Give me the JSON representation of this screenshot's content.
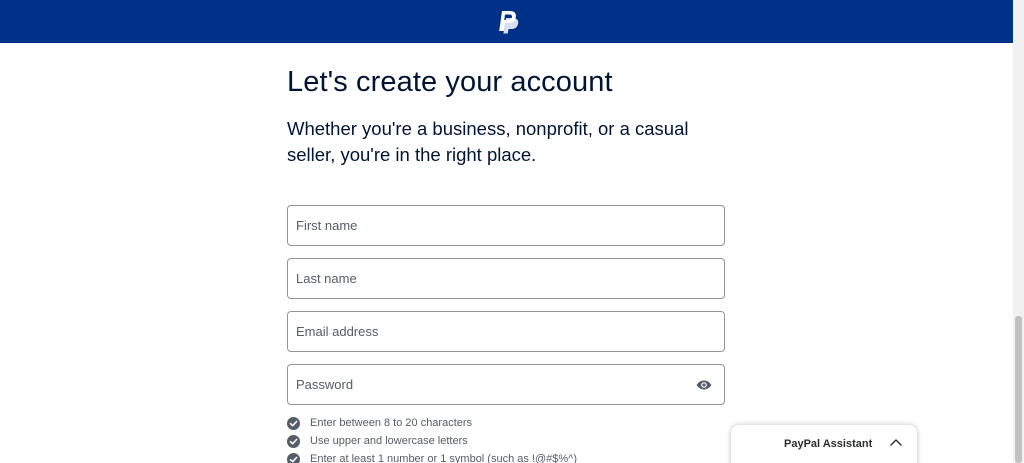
{
  "brand": {
    "logo_icon": "paypal-logo-icon",
    "header_color": "#003087"
  },
  "main": {
    "title": "Let's create your account",
    "subtitle": "Whether you're a business, nonprofit, or a casual seller, you're in the right place."
  },
  "form": {
    "first_name": {
      "placeholder": "First name",
      "value": ""
    },
    "last_name": {
      "placeholder": "Last name",
      "value": ""
    },
    "email": {
      "placeholder": "Email address",
      "value": ""
    },
    "password": {
      "placeholder": "Password",
      "value": "",
      "toggle_icon": "eye-icon"
    }
  },
  "password_rules": [
    {
      "text": "Enter between 8 to 20 characters",
      "icon": "check-circle-icon"
    },
    {
      "text": "Use upper and lowercase letters",
      "icon": "check-circle-icon"
    },
    {
      "text": "Enter at least 1 number or 1 symbol (such as !@#$%^)",
      "icon": "check-circle-icon"
    }
  ],
  "assistant": {
    "label": "PayPal Assistant",
    "toggle_icon": "chevron-up-icon"
  }
}
